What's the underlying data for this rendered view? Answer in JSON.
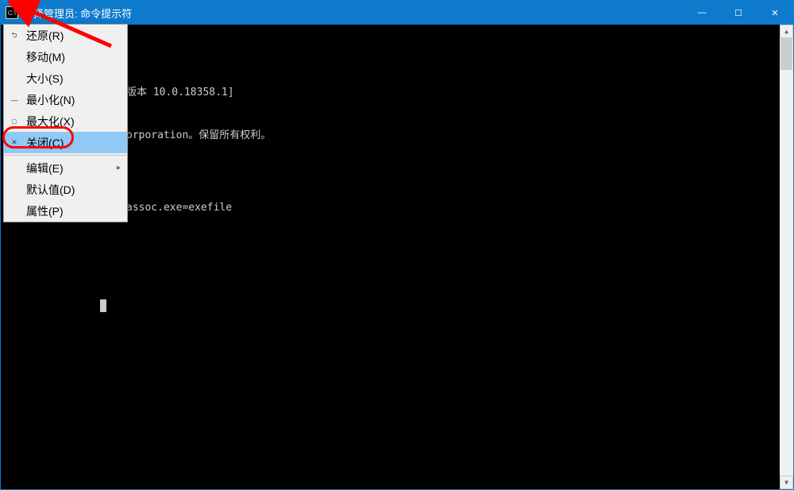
{
  "titlebar": {
    "icon_text": "C:\\",
    "title": "选择管理员: 命令提示符"
  },
  "window_controls": {
    "minimize": "—",
    "maximize": "☐",
    "close": "✕"
  },
  "console": {
    "line1": "版本 10.0.18358.1]",
    "line2": "orporation。保留所有权利。",
    "line3": "",
    "line4": "assoc.exe=exefile"
  },
  "menu": {
    "items": [
      {
        "icon": "⮌",
        "label": "还原(R)",
        "has_submenu": false
      },
      {
        "icon": "",
        "label": "移动(M)",
        "has_submenu": false
      },
      {
        "icon": "",
        "label": "大小(S)",
        "has_submenu": false
      },
      {
        "icon": "—",
        "label": "最小化(N)",
        "has_submenu": false
      },
      {
        "icon": "□",
        "label": "最大化(X)",
        "has_submenu": false
      },
      {
        "icon": "✕",
        "label": "关闭(C)",
        "has_submenu": false,
        "highlighted": true
      },
      {
        "icon": "",
        "label": "编辑(E)",
        "has_submenu": true
      },
      {
        "icon": "",
        "label": "默认值(D)",
        "has_submenu": false
      },
      {
        "icon": "",
        "label": "属性(P)",
        "has_submenu": false
      }
    ],
    "submenu_indicator": "▸"
  }
}
